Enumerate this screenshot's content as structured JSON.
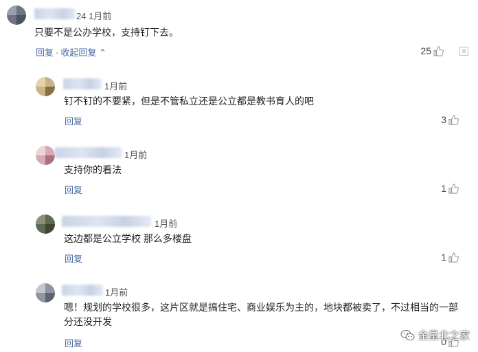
{
  "comments": [
    {
      "meta_suffix": "24 1月前",
      "text": "只要不是公办学校，支持钉下去。",
      "reply_label": "回复",
      "collapse_label": "收起回复",
      "likes": "25"
    },
    {
      "meta_suffix": "1月前",
      "text": "钉不钉的不要紧，但是不管私立还是公立都是教书育人的吧",
      "reply_label": "回复",
      "likes": "3"
    },
    {
      "meta_suffix": "1月前",
      "text": "支持你的看法",
      "reply_label": "回复",
      "likes": "1"
    },
    {
      "meta_suffix": "1月前",
      "text": "这边都是公立学校 那么多楼盘",
      "reply_label": "回复",
      "likes": "1"
    },
    {
      "meta_suffix": "1月前",
      "text": "嗯！规划的学校很多，这片区就是搞住宅、商业娱乐为主的，地块都被卖了，不过相当的一部分还没开发",
      "reply_label": "回复",
      "likes": "0"
    }
  ],
  "watermark": {
    "text": "金星北之家"
  },
  "icons": {
    "like": "thumbs-up-icon",
    "more": "close-icon",
    "wechat": "wechat-icon"
  }
}
